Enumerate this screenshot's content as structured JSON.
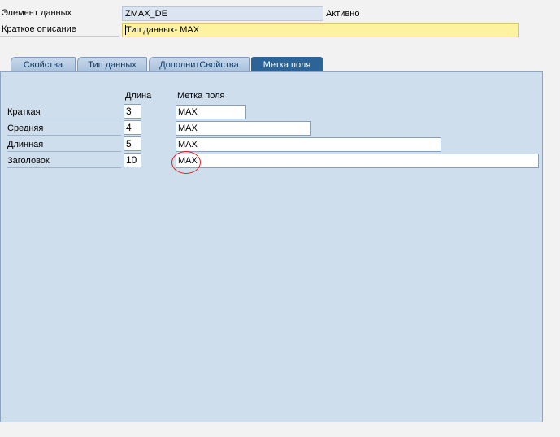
{
  "header": {
    "element_label": "Элемент данных",
    "element_value": "ZMAX_DE",
    "status": "Активно",
    "short_desc_label": "Краткое описание",
    "short_desc_value": "Тип данных- MAX"
  },
  "tabs": [
    {
      "label": "Свойства",
      "active": false
    },
    {
      "label": "Тип данных",
      "active": false
    },
    {
      "label": "ДополнитСвойства",
      "active": false
    },
    {
      "label": "Метка поля",
      "active": true
    }
  ],
  "field_labels": {
    "col_length": "Длина",
    "col_label": "Метка поля",
    "rows": [
      {
        "name": "Краткая",
        "length": "3",
        "label": "MAX"
      },
      {
        "name": "Средняя",
        "length": "4",
        "label": "MAX"
      },
      {
        "name": "Длинная",
        "length": "5",
        "label": "MAX"
      },
      {
        "name": "Заголовок",
        "length": "10",
        "label": "MAX"
      }
    ]
  },
  "colors": {
    "active_tab": "#2c6497",
    "panel": "#cfdeed",
    "desc_field": "#fdf2a0",
    "highlight_circle": "#dd2222"
  }
}
